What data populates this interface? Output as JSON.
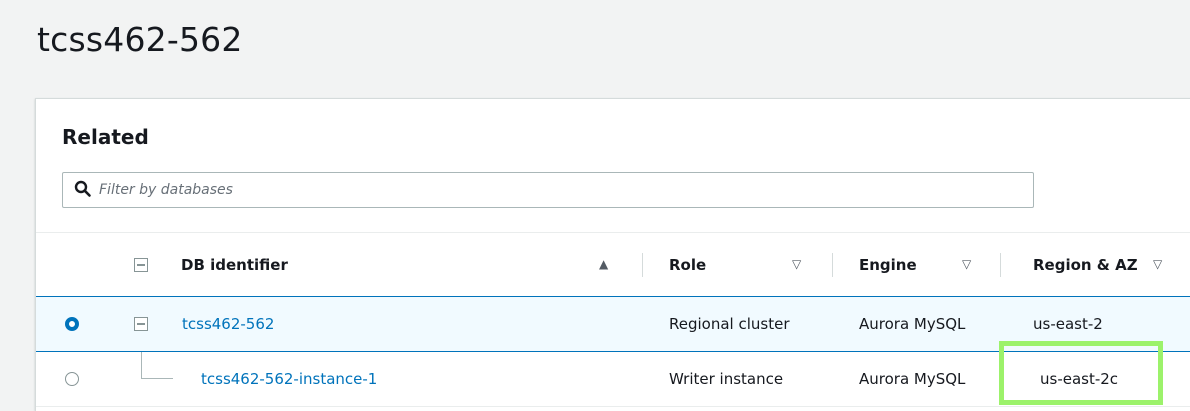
{
  "page": {
    "title": "tcss462-562"
  },
  "related": {
    "heading": "Related",
    "filter": {
      "placeholder": "Filter by databases",
      "value": ""
    }
  },
  "table": {
    "columns": [
      {
        "label": "DB identifier",
        "sort": "ascending"
      },
      {
        "label": "Role",
        "sort": "none"
      },
      {
        "label": "Engine",
        "sort": "none"
      },
      {
        "label": "Region & AZ",
        "sort": "none"
      }
    ],
    "rows": [
      {
        "selected": true,
        "db_identifier": "tcss462-562",
        "role": "Regional cluster",
        "engine": "Aurora MySQL",
        "region_az": "us-east-2"
      },
      {
        "selected": false,
        "db_identifier": "tcss462-562-instance-1",
        "role": "Writer instance",
        "engine": "Aurora MySQL",
        "region_az": "us-east-2c"
      }
    ]
  },
  "icons": {
    "search": "search-icon",
    "sort_asc": "▲",
    "sort_none": "▽"
  },
  "colors": {
    "link": "#0073bb",
    "highlight": "#9cf26b",
    "selected_row_bg": "#f1faff"
  }
}
